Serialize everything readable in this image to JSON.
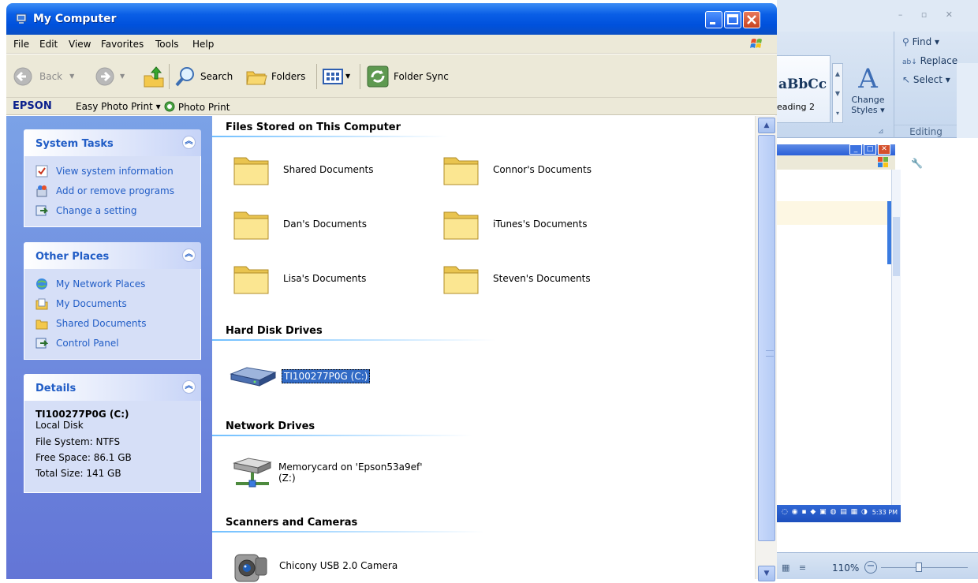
{
  "window": {
    "title": "My Computer"
  },
  "menubar": {
    "items": [
      "File",
      "Edit",
      "View",
      "Favorites",
      "Tools",
      "Help"
    ]
  },
  "toolbar": {
    "back": "Back",
    "search": "Search",
    "folders": "Folders",
    "folder_sync": "Folder Sync"
  },
  "epson_bar": {
    "brand": "EPSON",
    "easy_photo_print": "Easy Photo Print",
    "photo_print": "Photo Print"
  },
  "system_tasks": {
    "title": "System Tasks",
    "items": [
      "View system information",
      "Add or remove programs",
      "Change a setting"
    ]
  },
  "other_places": {
    "title": "Other Places",
    "items": [
      "My Network Places",
      "My Documents",
      "Shared Documents",
      "Control Panel"
    ]
  },
  "details": {
    "title": "Details",
    "name": "TI100277P0G (C:)",
    "type": "Local Disk",
    "file_system": "File System: NTFS",
    "free_space": "Free Space: 86.1 GB",
    "total_size": "Total Size: 141 GB"
  },
  "sections": {
    "files": "Files Stored on This Computer",
    "hard_disks": "Hard Disk Drives",
    "network": "Network Drives",
    "scanners": "Scanners and Cameras"
  },
  "files": [
    "Shared Documents",
    "Connor's Documents",
    "Dan's Documents",
    "iTunes's Documents",
    "Lisa's Documents",
    "Steven's Documents"
  ],
  "hard_disk": "TI100277P0G (C:)",
  "network_drive": {
    "line1": "Memorycard on 'Epson53a9ef'",
    "line2": "(Z:)"
  },
  "camera": "Chicony USB 2.0 Camera",
  "word": {
    "style_sample": "aBbCc",
    "style_name": "eading 2",
    "change_styles_1": "Change",
    "change_styles_2": "Styles",
    "find": "Find",
    "replace": "Replace",
    "select": "Select",
    "editing": "Editing",
    "clock": "5:33 PM",
    "zoom": "110%"
  }
}
